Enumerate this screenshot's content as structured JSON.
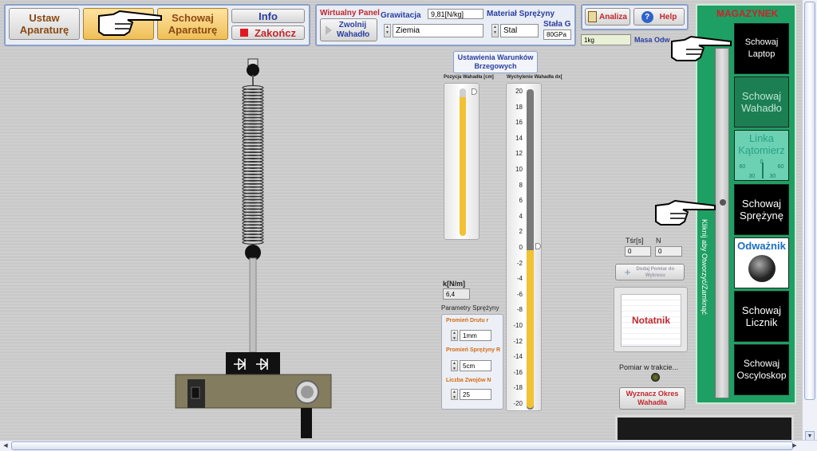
{
  "toolbar": {
    "ustaw": "Ustaw Aparaturę",
    "schowaj": "Schowaj Aparaturę",
    "info": "Info",
    "zakoncz": "Zakończ"
  },
  "virtual_panel": {
    "title": "Wirtualny Panel",
    "release_label": "Zwolnij Wahadło",
    "gravity_label": "Grawitacja",
    "gravity_value": "9,81[N/kg]",
    "gravity_selected": "Ziemia",
    "material_label": "Materiał Sprężyny",
    "material_selected": "Stal",
    "g_const_label": "Stała G",
    "g_const_value": "80GPa",
    "mass_value": "1kg",
    "mass_label": "Masa Odw"
  },
  "top_right": {
    "analiza": "Analiza",
    "help": "Help"
  },
  "boundary": {
    "title": "Ustawienia Warunków Brzegowych",
    "pos_label": "Pozycja Wahadła [cm]",
    "tilt_label": "Wychylenie Wahadła dx[",
    "ticks": [
      "20",
      "18",
      "16",
      "14",
      "12",
      "10",
      "8",
      "6",
      "4",
      "2",
      "0",
      "-2",
      "-4",
      "-6",
      "-8",
      "-10",
      "-12",
      "-14",
      "-16",
      "-18",
      "-20"
    ],
    "tilt_value": 0,
    "pos_fill": 0.94
  },
  "spring_params": {
    "k_label": "k[N/m]",
    "k_value": "6,4",
    "title": "Parametry Sprężyny",
    "wire_label": "Promień Drutu r",
    "wire_value": "1mm",
    "spring_r_label": "Promień Sprężyny R",
    "spring_r_value": "5cm",
    "coils_label": "Liczba Zwojów N",
    "coils_value": "25"
  },
  "measure": {
    "tsr_label": "Tśr[s]",
    "tsr_value": "0",
    "n_label": "N",
    "n_value": "0",
    "add_point": "Dodaj Pomiar do Wykresu",
    "notatnik": "Notatnik",
    "in_progress": "Pomiar w trakcie...",
    "wyznacz": "Wyznacz Okres Wahadła"
  },
  "magazyn": {
    "title": "MAGAZYNEK",
    "vertical_text": "Kliknij aby Otworzyć/Zamknąć",
    "items": {
      "laptop": "Schowaj Laptop",
      "wahadlo": "Schowaj Wahadło",
      "katomierz": "Linka Kątomierz",
      "sprezyne": "Schowaj Sprężynę",
      "odwaznik": "Odważnik",
      "licznik": "Schowaj Licznik",
      "oscyloskop": "Schowaj Oscyloskop"
    },
    "dial_ticks": [
      "60",
      "30",
      "0",
      "30",
      "60"
    ]
  },
  "colors": {
    "accent_gold": "#f1c233",
    "magazyn_green": "#1e9f63",
    "panel_blue": "#8aa0c8"
  }
}
